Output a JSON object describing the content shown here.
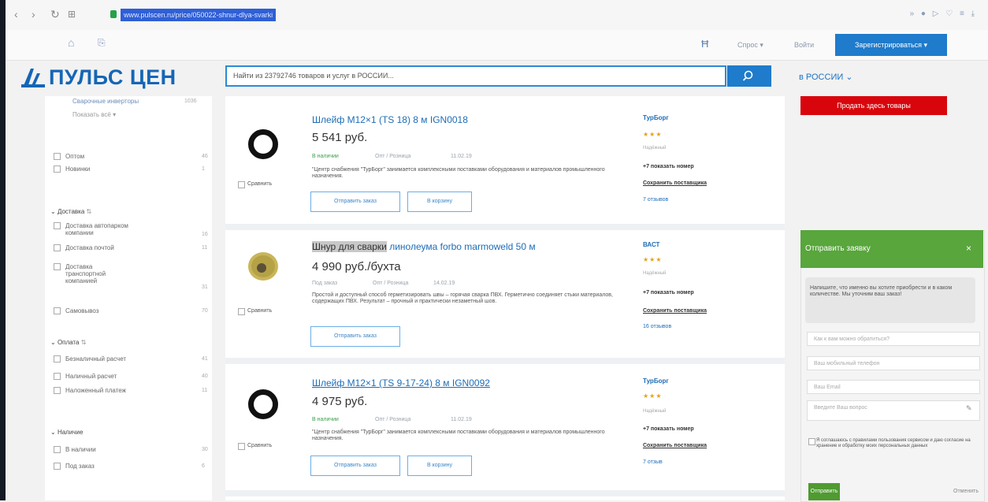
{
  "browser": {
    "url": "www.pulscen.ru/price/050022-shnur-dlya-svarki",
    "right_icons": "» ● ▷ ♡ ≡ ⤓"
  },
  "header": {
    "cart": "Ħ",
    "help": "Спрос ▾",
    "login": "Войти",
    "register": "Зарегистрироваться ▾"
  },
  "logo": "ПУЛЬС ЦЕН",
  "search": {
    "placeholder": "Найти из 23792746 товаров и услуг в РОССИИ..."
  },
  "region": "в РОССИИ ⌄",
  "sidebar": {
    "top_link": "Сварочные инверторы",
    "top_count": "1036",
    "show_all": "Показать всё ▾",
    "condition": [
      {
        "label": "Оптом",
        "count": "46"
      },
      {
        "label": "Новинки",
        "count": "1"
      }
    ],
    "delivery_title": "Доставка",
    "delivery": [
      {
        "label": "Доставка автопарком компании",
        "count": "16"
      },
      {
        "label": "Доставка почтой",
        "count": "11"
      },
      {
        "label": "Доставка транспортной компанией",
        "count": "31"
      },
      {
        "label": "Самовывоз",
        "count": "70"
      }
    ],
    "payment_title": "Оплата",
    "payment": [
      {
        "label": "Безналичный расчет",
        "count": "41"
      },
      {
        "label": "Наличный расчет",
        "count": "40"
      },
      {
        "label": "Наложенный платеж",
        "count": "11"
      }
    ],
    "stock_title": "Наличие",
    "stock": [
      {
        "label": "В наличии",
        "count": "30"
      },
      {
        "label": "Под заказ",
        "count": "6"
      }
    ]
  },
  "products": [
    {
      "title": "Шлейф M12×1 (TS 18) 8 м IGN0018",
      "price": "5 541 руб.",
      "meta": [
        "В наличии",
        "Опт / Розница",
        "11.02.19"
      ],
      "desc": "\"Центр снабжения \"ТурБорг\" занимается комплексными поставками оборудования и материалов промышленного назначения.",
      "compare": "Сравнить",
      "btn_order": "Отправить заказ",
      "btn_cart": "В корзину",
      "seller": "ТурБорг",
      "stars": "★★★",
      "seller_note": "Надёжный",
      "phone": "+7 показать номер",
      "save": "Сохранить поставщика",
      "reviews": "7 отзывов"
    },
    {
      "title_hl": "Шнур для сварки",
      "title_rest": " линолеума forbo marmoweld 50 м",
      "price": "4 990 руб./бухта",
      "meta": [
        "Под заказ",
        "Опт / Розница",
        "14.02.19"
      ],
      "desc": "Простой и доступный способ герметизировать швы – горячая сварка ПВХ. Герметично соединяет стыки материалов, содержащих ПВХ. Результат – прочный и практически незаметный шов.",
      "compare": "Сравнить",
      "btn_order": "Отправить заказ",
      "seller": "ВАСТ",
      "stars": "★★★",
      "seller_note": "Надёжный",
      "phone": "+7 показать номер",
      "save": "Сохранить поставщика",
      "reviews": "16 отзывов"
    },
    {
      "title": "Шлейф M12×1 (TS 9-17-24) 8 м IGN0092",
      "price": "4 975 руб.",
      "meta": [
        "В наличии",
        "Опт / Розница",
        "11.02.19"
      ],
      "desc": "\"Центр снабжения \"ТурБорг\" занимается комплексными поставками оборудования и материалов промышленного назначения.",
      "compare": "Сравнить",
      "btn_order": "Отправить заказ",
      "btn_cart": "В корзину",
      "seller": "ТурБорг",
      "stars": "★★★",
      "seller_note": "Надёжный",
      "phone": "+7 показать номер",
      "save": "Сохранить поставщика",
      "reviews": "7 отзыв"
    }
  ],
  "sell_button": "Продать здесь товары",
  "form": {
    "title": "Отправить заявку",
    "close": "×",
    "intro": "Напишите, что именно вы хотите приобрести и в каком количестве. Мы уточним ваш заказ!",
    "name_ph": "Как к вам можно обратиться?",
    "phone_ph": "Ваш мобильный телефон",
    "email_ph": "Ваш Email",
    "question_ph": "Введите Ваш вопрос",
    "consent": "Я соглашаюсь с правилами пользования сервисом и даю согласие на хранение и обработку моих персональных данных",
    "submit": "Отправить",
    "cancel": "Отменить"
  }
}
